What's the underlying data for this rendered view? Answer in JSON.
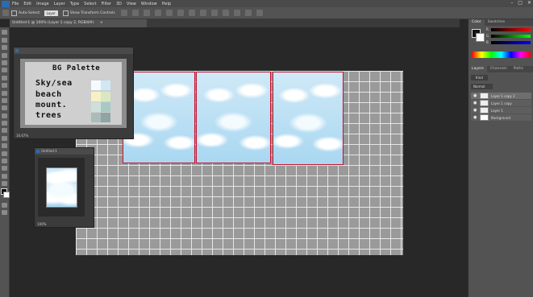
{
  "app": {
    "menus": [
      "File",
      "Edit",
      "Image",
      "Layer",
      "Type",
      "Select",
      "Filter",
      "3D",
      "View",
      "Window",
      "Help"
    ],
    "window_controls": [
      "–",
      "□",
      "✕"
    ]
  },
  "options_bar": {
    "auto_select_label": "Auto-Select:",
    "auto_select_value": "Layer",
    "show_transform_label": "Show Transform Controls"
  },
  "document_tab": {
    "title": "Untitled-1 @ 100% (Layer 1 copy 2, RGB/8#)",
    "close": "×"
  },
  "palette_window": {
    "heading": "BG Palette",
    "rows": [
      {
        "label": "Sky/sea",
        "colors": [
          "#f5fbff",
          "#cfe8f5"
        ]
      },
      {
        "label": "beach",
        "colors": [
          "#f6f0c6",
          "#d9e8c2"
        ]
      },
      {
        "label": "mount.",
        "colors": [
          "#cfe0dc",
          "#a9c9c4"
        ]
      },
      {
        "label": "trees",
        "colors": [
          "#a9bcba",
          "#8fa4a3"
        ]
      }
    ],
    "zoom": "16.67%"
  },
  "small_window": {
    "title": "Untitled-1",
    "zoom": "100%"
  },
  "right_panel": {
    "color_tabs": [
      "Color",
      "Swatches"
    ],
    "sliders": [
      "R",
      "G",
      "B"
    ],
    "layer_tabs": [
      "Layers",
      "Channels",
      "Paths"
    ],
    "blend_mode": "Normal",
    "kind_label": "Kind",
    "layers": [
      {
        "name": "Layer 1 copy 2",
        "selected": true
      },
      {
        "name": "Layer 1 copy",
        "selected": false
      },
      {
        "name": "Layer 1",
        "selected": false
      },
      {
        "name": "Background",
        "selected": false
      }
    ]
  },
  "colors": {
    "frame_border": "#c8102e",
    "sky_top": "#cfe9f7",
    "sky_bottom": "#a9d7f1"
  }
}
